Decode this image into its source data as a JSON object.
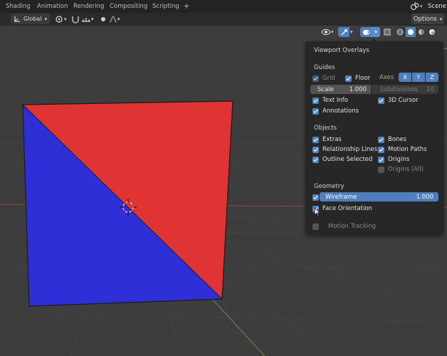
{
  "topbar": {
    "tabs": [
      "Shading",
      "Animation",
      "Rendering",
      "Compositing",
      "Scripting"
    ],
    "add_tab": "+",
    "scene": "Scene"
  },
  "toolbar": {
    "orientation": "Global",
    "options": "Options"
  },
  "overlays": {
    "title": "Viewport Overlays",
    "guides": {
      "heading": "Guides",
      "grid": {
        "label": "Grid",
        "checked": true,
        "enabled": false
      },
      "floor": {
        "label": "Floor",
        "checked": true
      },
      "axes_label": "Axes",
      "axes": [
        "X",
        "Y",
        "Z"
      ],
      "scale": {
        "label": "Scale",
        "value": "1.000"
      },
      "subdivisions": {
        "label": "Subdivisions",
        "value": "10"
      },
      "text_info": {
        "label": "Text Info",
        "checked": true
      },
      "cursor_3d": {
        "label": "3D Cursor",
        "checked": true
      },
      "annotations": {
        "label": "Annotations",
        "checked": true
      }
    },
    "objects": {
      "heading": "Objects",
      "extras": {
        "label": "Extras",
        "checked": true
      },
      "bones": {
        "label": "Bones",
        "checked": true
      },
      "relationship_lines": {
        "label": "Relationship Lines",
        "checked": true
      },
      "motion_paths": {
        "label": "Motion Paths",
        "checked": true
      },
      "outline_selected": {
        "label": "Outline Selected",
        "checked": true
      },
      "origins": {
        "label": "Origins",
        "checked": true
      },
      "origins_all": {
        "label": "Origins (All)",
        "checked": false
      }
    },
    "geometry": {
      "heading": "Geometry",
      "wireframe": {
        "label": "Wireframe",
        "value": "1.000",
        "checked": true
      },
      "face_orientation": {
        "label": "Face Orientation",
        "checked": true
      },
      "motion_tracking": {
        "label": "Motion Tracking",
        "checked": false
      }
    }
  },
  "colors": {
    "accent": "#4f86c6",
    "face_front": "#2f2fd8",
    "face_back": "#e03434",
    "viewport_bg": "#3d3d3d",
    "popup_bg": "#272727"
  }
}
